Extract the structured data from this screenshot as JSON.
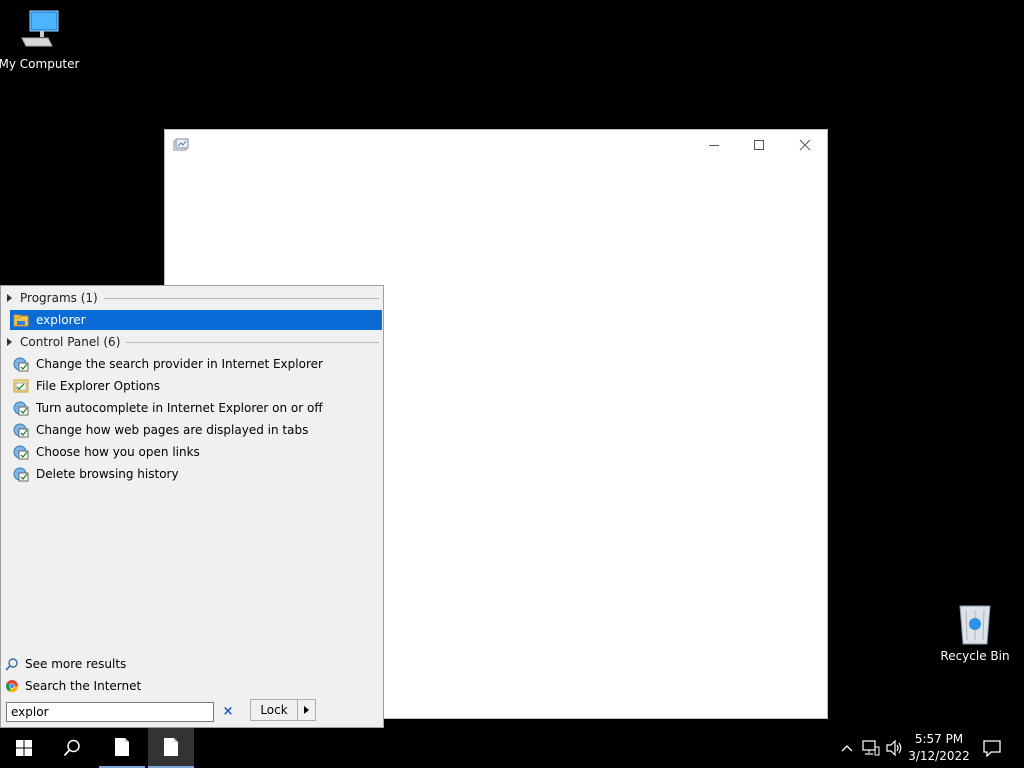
{
  "desktop": {
    "icons": [
      {
        "label": "My Computer",
        "icon": "computer-icon"
      },
      {
        "label": "Recycle Bin",
        "icon": "recycle-bin-icon"
      }
    ]
  },
  "window": {
    "app_icon": "app-window-icon",
    "controls": {
      "minimize": "minimize-icon",
      "maximize": "maximize-icon",
      "close": "close-icon"
    }
  },
  "start_menu": {
    "groups": [
      {
        "header": "Programs (1)",
        "items": [
          {
            "label": "explorer",
            "icon": "folder-icon",
            "selected": true
          }
        ]
      },
      {
        "header": "Control Panel (6)",
        "items": [
          {
            "label": "Change the search provider in Internet Explorer",
            "icon": "internet-options-icon"
          },
          {
            "label": "File Explorer Options",
            "icon": "folder-options-icon"
          },
          {
            "label": "Turn autocomplete in Internet Explorer on or off",
            "icon": "internet-options-icon"
          },
          {
            "label": "Change how web pages are displayed in tabs",
            "icon": "internet-options-icon"
          },
          {
            "label": "Choose how you open links",
            "icon": "internet-options-icon"
          },
          {
            "label": "Delete browsing history",
            "icon": "internet-options-icon"
          }
        ]
      }
    ],
    "see_more": "See more results",
    "search_internet": "Search the Internet",
    "search_value": "explor",
    "clear_label": "×",
    "lock_label": "Lock"
  },
  "taskbar": {
    "time": "5:57 PM",
    "date": "3/12/2022"
  },
  "colors": {
    "selection": "#0a6ad6",
    "menu_bg": "#f0f0f0",
    "desktop_bg": "#000000"
  }
}
